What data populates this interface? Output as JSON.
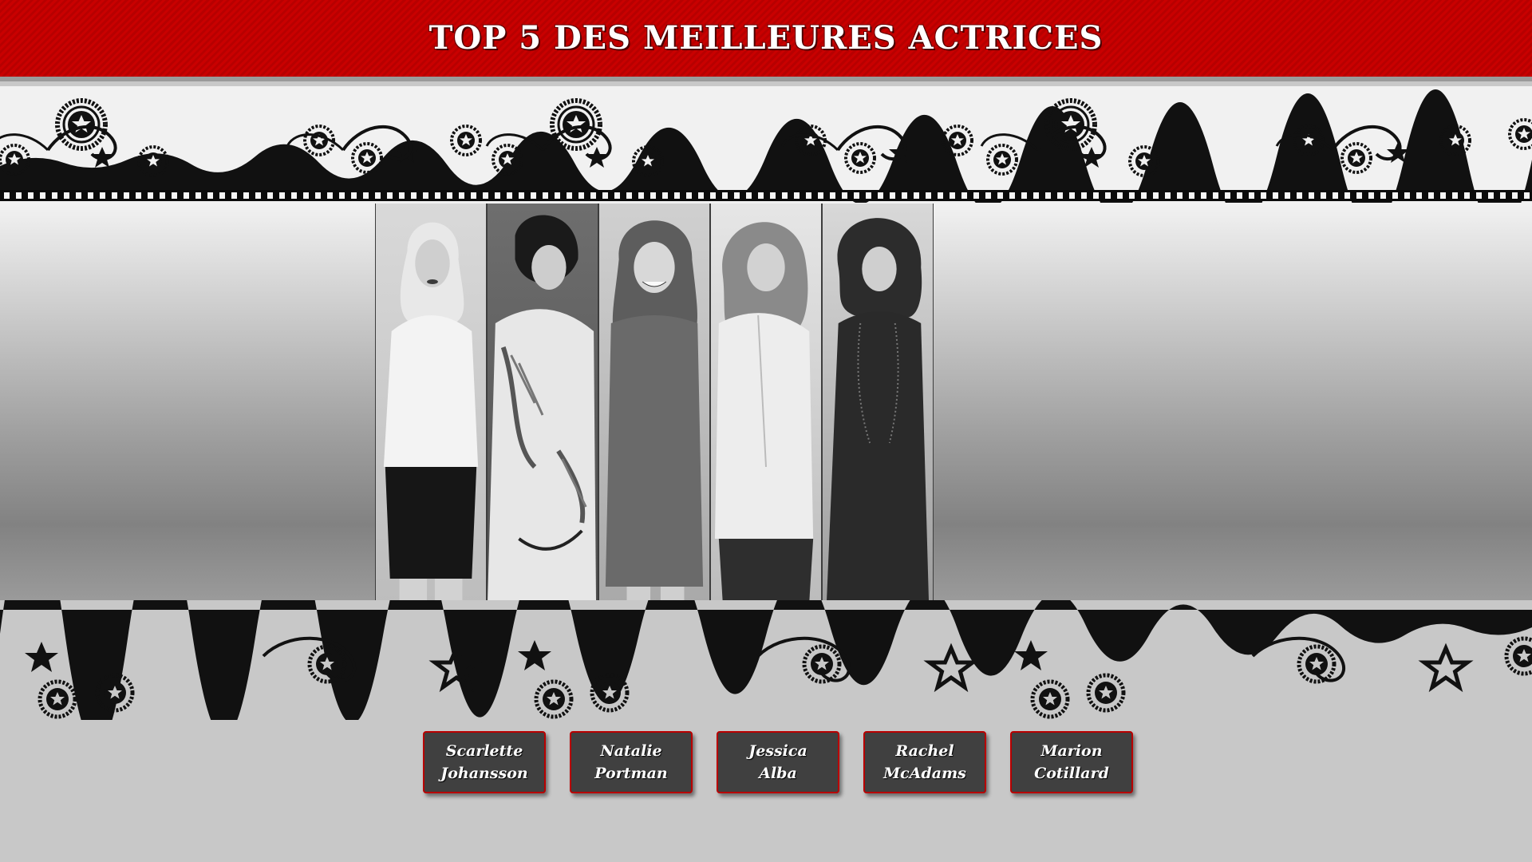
{
  "header": {
    "title": "TOP 5 DES MEILLEURES ACTRICES"
  },
  "colors": {
    "banner_red": "#c90000",
    "button_bg": "#404040",
    "button_border": "#b80000"
  },
  "gallery": {
    "portraits": [
      {
        "icon": "portrait-photo"
      },
      {
        "icon": "portrait-photo"
      },
      {
        "icon": "portrait-photo"
      },
      {
        "icon": "portrait-photo"
      },
      {
        "icon": "portrait-photo"
      }
    ]
  },
  "buttons": [
    {
      "line1": "Scarlette",
      "line2": "Johansson"
    },
    {
      "line1": "Natalie",
      "line2": "Portman"
    },
    {
      "line1": "Jessica",
      "line2": "Alba"
    },
    {
      "line1": "Rachel",
      "line2": "McAdams"
    },
    {
      "line1": "Marion",
      "line2": "Cotillard"
    }
  ]
}
